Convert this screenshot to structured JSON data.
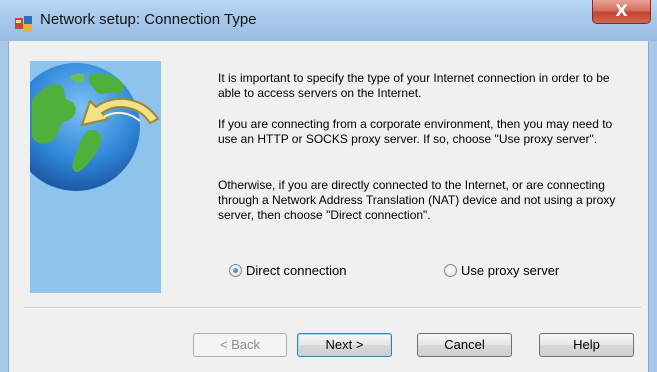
{
  "window": {
    "title": "Network setup: Connection Type",
    "close_glyph": "X",
    "title_icon": "network-app-icon"
  },
  "banner": {
    "icon": "globe-with-arrow-icon",
    "colors": {
      "background": "#8ec3ec",
      "ocean": "#2f86d8",
      "land": "#4fb13c",
      "arrow": "#f3e08a"
    }
  },
  "content": {
    "paragraphs": [
      "It is important to specify the type of your Internet connection in order to be able to access servers on the Internet.",
      "If you are connecting from a corporate environment, then you may need to use an HTTP or SOCKS proxy server. If so, choose \"Use proxy server\".",
      "Otherwise, if you are directly connected to the Internet, or are connecting through a Network Address Translation (NAT) device and not using a proxy server, then choose \"Direct connection\"."
    ]
  },
  "options": {
    "direct": {
      "label": "Direct connection",
      "checked": true
    },
    "proxy": {
      "label": "Use proxy server",
      "checked": false
    }
  },
  "buttons": {
    "back": "< Back",
    "next": "Next >",
    "cancel": "Cancel",
    "help": "Help"
  }
}
